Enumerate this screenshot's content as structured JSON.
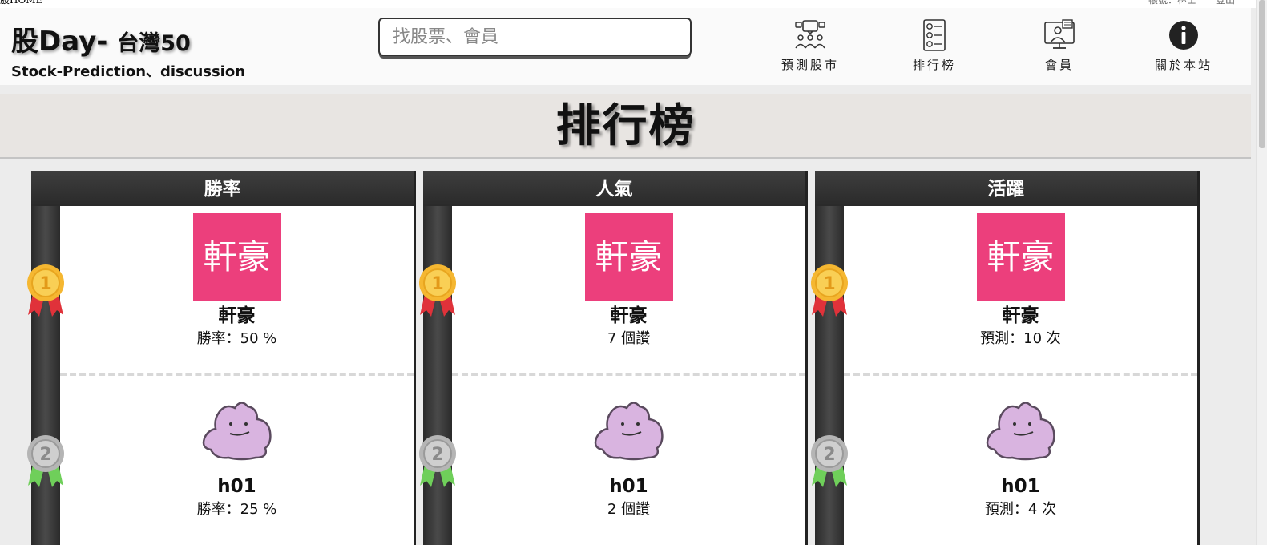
{
  "top_strip": {
    "left": "股HOME",
    "right": "帳號：林士　　登出"
  },
  "brand": {
    "title": "股Day-",
    "subtitle": "台灣50",
    "tagline": "Stock-Prediction、discussion"
  },
  "search": {
    "placeholder": "找股票、會員",
    "value": ""
  },
  "nav": [
    {
      "label": "預測股市",
      "icon": "predict-market-icon"
    },
    {
      "label": "排行榜",
      "icon": "leaderboard-icon"
    },
    {
      "label": "會員",
      "icon": "member-icon"
    },
    {
      "label": "關於本站",
      "icon": "info-icon"
    }
  ],
  "page_title": "排行榜",
  "boards": [
    {
      "title": "勝率",
      "entries": [
        {
          "rank": "1",
          "avatar_text": "軒豪",
          "name": "軒豪",
          "stat": "勝率：50 %"
        },
        {
          "rank": "2",
          "avatar_icon": "ditto-avatar-icon",
          "name": "h01",
          "stat": "勝率：25 %"
        }
      ]
    },
    {
      "title": "人氣",
      "entries": [
        {
          "rank": "1",
          "avatar_text": "軒豪",
          "name": "軒豪",
          "stat": "7 個讚"
        },
        {
          "rank": "2",
          "avatar_icon": "ditto-avatar-icon",
          "name": "h01",
          "stat": "2 個讚"
        }
      ]
    },
    {
      "title": "活躍",
      "entries": [
        {
          "rank": "1",
          "avatar_text": "軒豪",
          "name": "軒豪",
          "stat": "預測：10 次"
        },
        {
          "rank": "2",
          "avatar_icon": "ditto-avatar-icon",
          "name": "h01",
          "stat": "預測：4 次"
        }
      ]
    }
  ],
  "colors": {
    "avatar_bg": "#ec3f7c",
    "gold": "#f5b731",
    "silver": "#b5b5b5",
    "ribbon_red": "#e0323a",
    "ribbon_green": "#6fcf5a"
  }
}
